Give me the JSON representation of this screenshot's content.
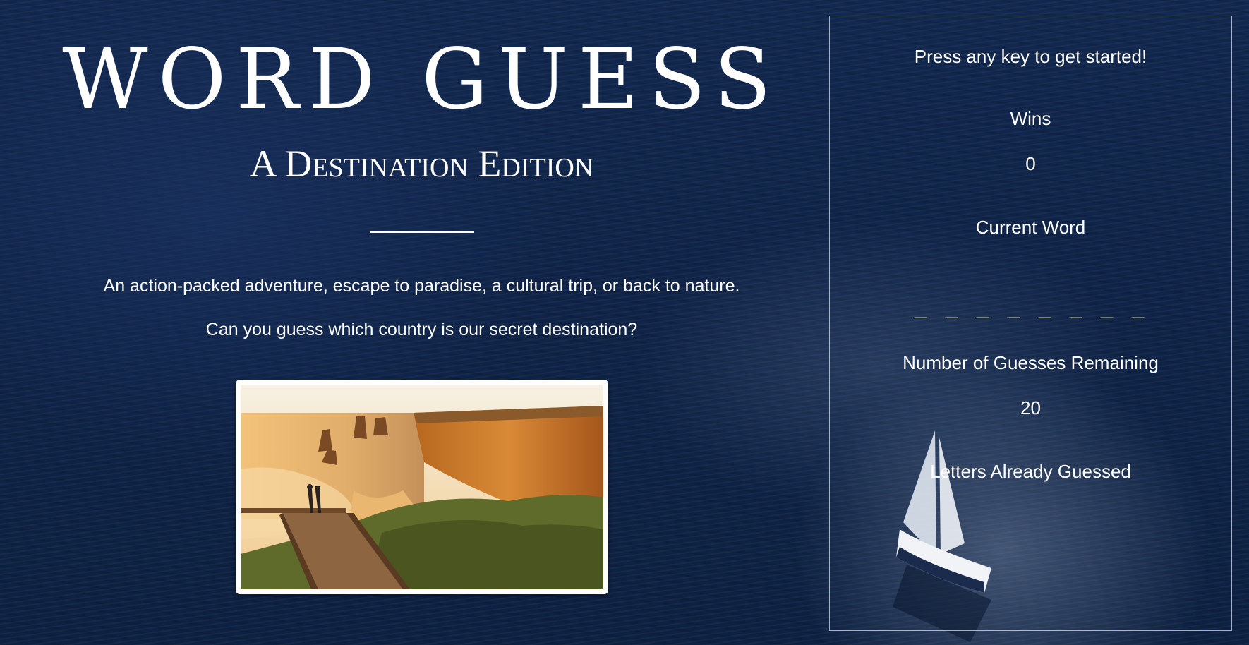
{
  "header": {
    "title": "WORD GUESS",
    "subtitle": "A Destination Edition"
  },
  "intro": {
    "tagline": "An action-packed adventure, escape to paradise, a cultural trip, or back to nature.",
    "question": "Can you guess which country is our secret destination?"
  },
  "scoreboard": {
    "prompt": "Press any key to get started!",
    "wins_label": "Wins",
    "wins_value": "0",
    "current_word_label": "Current Word",
    "current_word_blanks": "_ _ _ _ _ _ _ _",
    "guesses_label": "Number of Guesses Remaining",
    "guesses_value": "20",
    "letters_label": "Letters Already Guessed",
    "letters_value": ""
  },
  "colors": {
    "ocean": "#0f2448",
    "text": "#ffffff",
    "panel_border": "#dce1eb"
  },
  "icons": {
    "destination_photo": "coastal-cliffs-photo",
    "background_boat": "sailboat-illustration"
  }
}
